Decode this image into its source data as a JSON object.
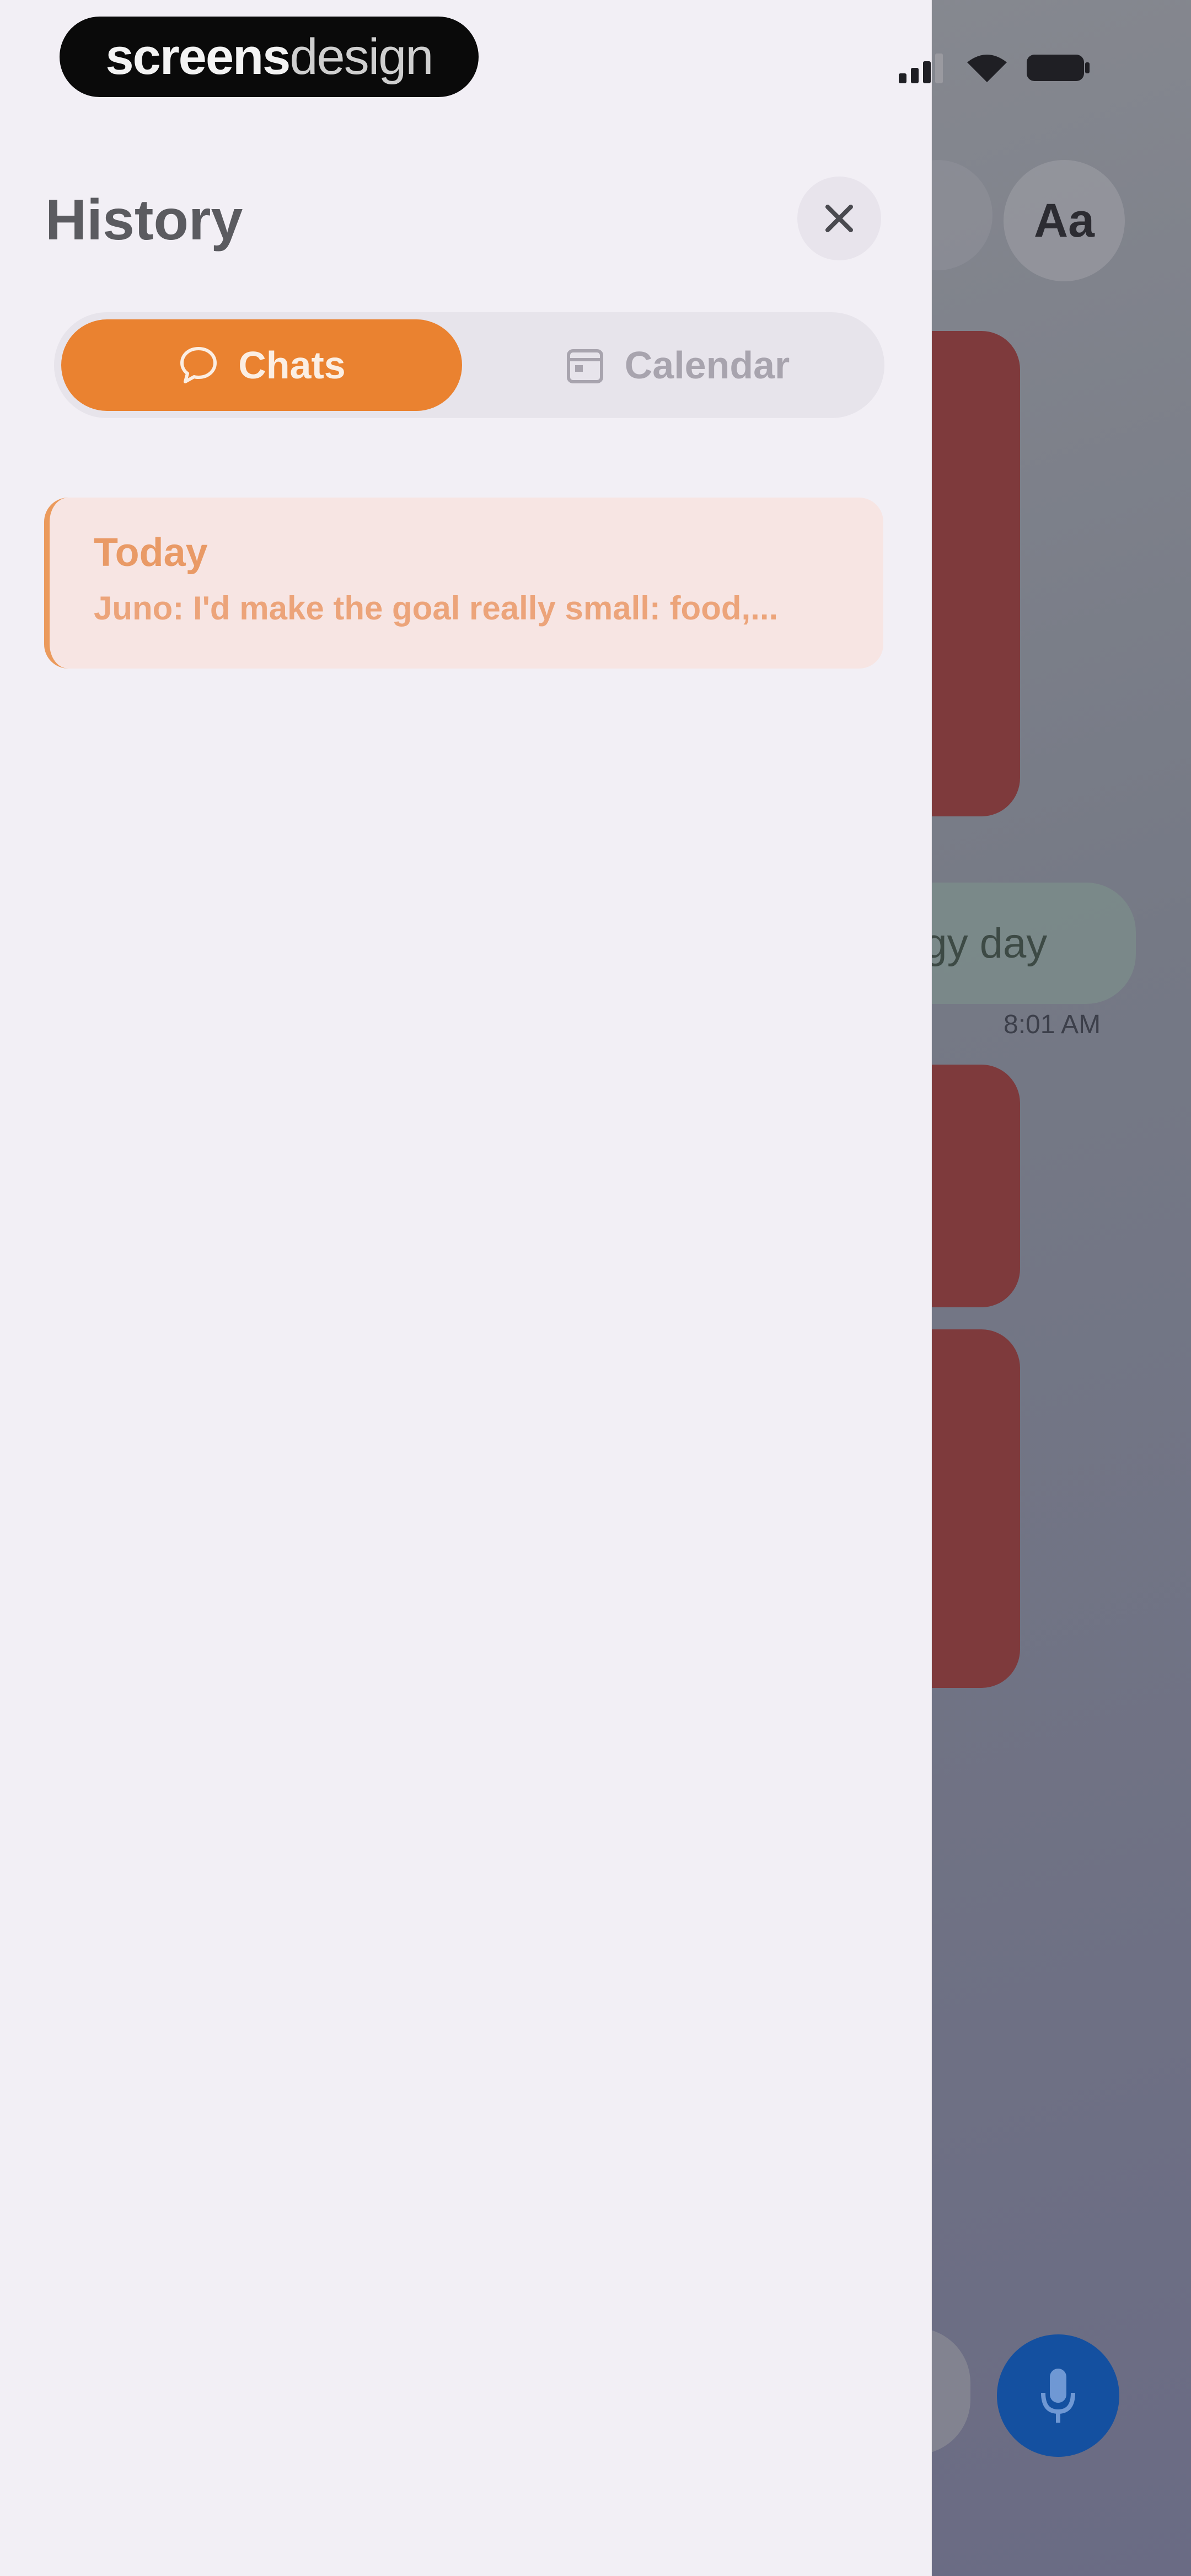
{
  "status_bar": {
    "brand_strong": "screens",
    "brand_light": "design",
    "icons": [
      "cellular-signal-icon",
      "wifi-icon",
      "battery-icon"
    ]
  },
  "drawer": {
    "title": "History",
    "tabs": [
      {
        "label": "Chats",
        "icon": "chat-bubble-icon",
        "active": true
      },
      {
        "label": "Calendar",
        "icon": "calendar-icon",
        "active": false
      }
    ],
    "items": [
      {
        "date": "Today",
        "preview": "Juno: I'd make the goal really small: food,..."
      }
    ]
  },
  "background": {
    "font_button_label": "Aa",
    "user_message_fragment": "rgy day",
    "message_time": "8:01 AM"
  },
  "colors": {
    "accent": "#ea8230",
    "drawer_bg": "#f2eff5",
    "assistant_bubble": "#7e3a3c",
    "mic_button": "#1450a0"
  }
}
